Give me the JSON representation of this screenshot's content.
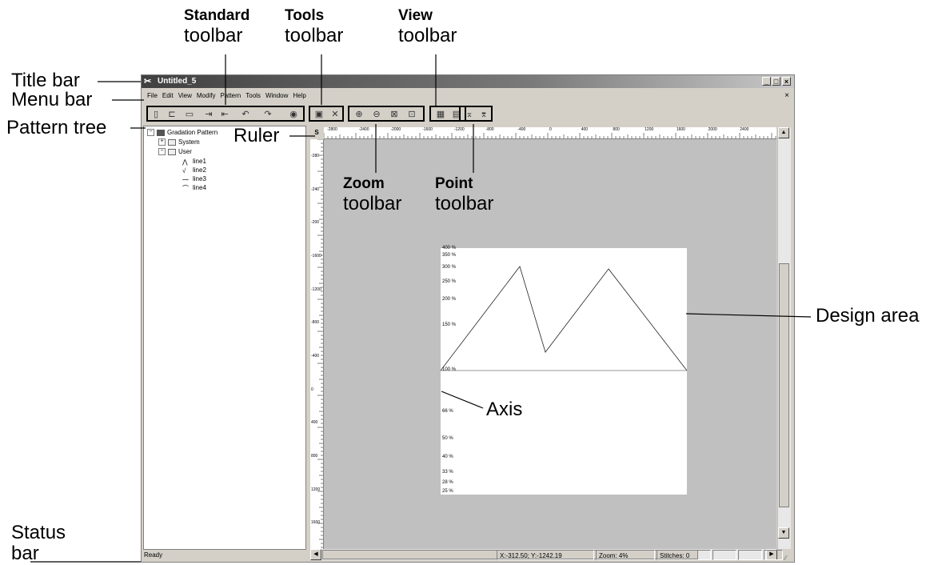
{
  "callouts": {
    "standard_bold": "Standard",
    "standard_sub": "toolbar",
    "tools_bold": "Tools",
    "tools_sub": "toolbar",
    "view_bold": "View",
    "view_sub": "toolbar",
    "title_bar": "Title bar",
    "menu_bar": "Menu bar",
    "pattern_tree": "Pattern tree",
    "ruler": "Ruler",
    "zoom_bold": "Zoom",
    "zoom_sub": "toolbar",
    "point_bold": "Point",
    "point_sub": "toolbar",
    "design_area": "Design area",
    "axis": "Axis",
    "status_line1": "Status",
    "status_line2": "bar"
  },
  "window": {
    "title": "Untitled_5",
    "buttons": [
      "_",
      "□",
      "×"
    ],
    "mdi_close": "×"
  },
  "menu": [
    "File",
    "Edit",
    "View",
    "Modify",
    "Pattern",
    "Tools",
    "Window",
    "Help"
  ],
  "tree": {
    "root": "Gradation Pattern",
    "system": "System",
    "user": "User",
    "lines": [
      "line1",
      "line2",
      "line3",
      "line4"
    ],
    "expanders": {
      "root": "−",
      "system": "+",
      "user": "−"
    }
  },
  "ruler": {
    "corner": "S",
    "h_labels": [
      "-2800",
      "-2400",
      "-2000",
      "-1600",
      "-1200",
      "-800",
      "-400",
      "0",
      "400",
      "800",
      "1200",
      "1600",
      "2000",
      "2400"
    ],
    "v_labels": [
      "-280",
      "-240",
      "-200",
      "-1600",
      "-1200",
      "-800",
      "-400",
      "0",
      "400",
      "800",
      "1200",
      "1600"
    ]
  },
  "canvas": {
    "y_labels": [
      "400 %",
      "350 %",
      "300 %",
      "250 %",
      "200 %",
      "150 %",
      "100 %",
      "66 %",
      "50 %",
      "40 %",
      "33 %",
      "28 %",
      "25 %"
    ]
  },
  "status": {
    "ready": "Ready",
    "coords": "X:-312.50; Y:-1242.19",
    "zoom": "Zoom: 4%",
    "stitches": "Stitches: 0"
  },
  "icons": {
    "app": "app-icon",
    "toolbar_standard": [
      "new-icon",
      "open-icon",
      "save-icon",
      "import-icon",
      "export-icon",
      "undo-icon",
      "redo-icon",
      "help-icon"
    ],
    "toolbar_tools": [
      "select-tool-icon",
      "edit-tool-icon"
    ],
    "toolbar_zoom": [
      "zoom-in-icon",
      "zoom-out-icon",
      "zoom-fit-icon",
      "zoom-page-icon"
    ],
    "toolbar_view": [
      "grid-icon",
      "ruler-view-icon"
    ],
    "toolbar_point": [
      "add-point-icon",
      "delete-point-icon"
    ]
  }
}
